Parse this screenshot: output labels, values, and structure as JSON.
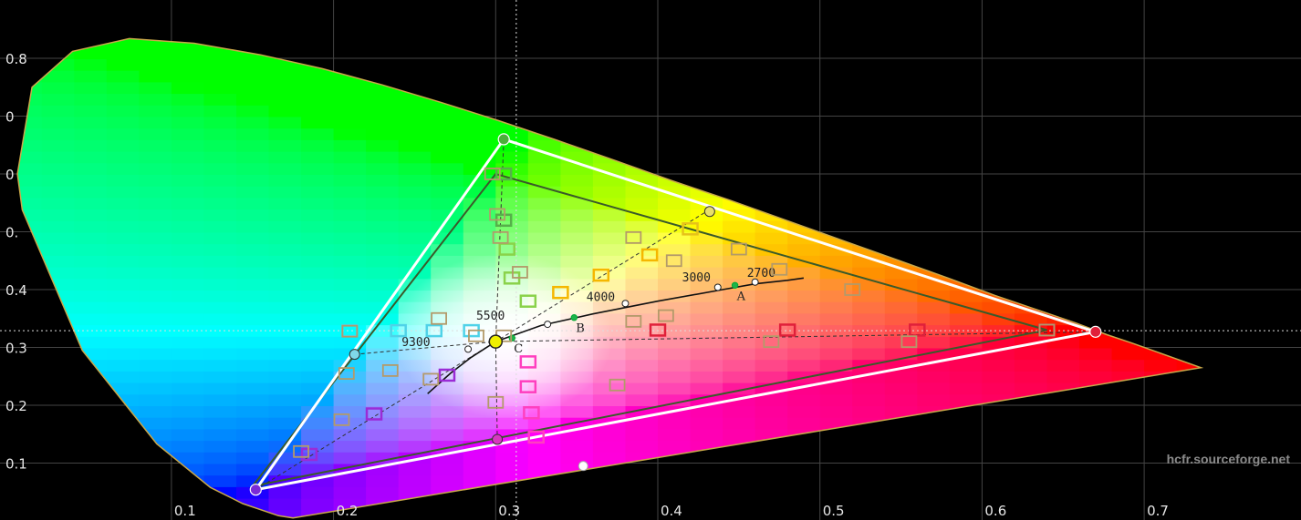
{
  "chart_data": {
    "type": "scatter",
    "title": "",
    "xlabel": "",
    "ylabel": "",
    "xlim": [
      0.0,
      0.8
    ],
    "ylim": [
      0.0,
      0.88
    ],
    "grid": true,
    "x_ticks": [
      "0.1",
      "0.2",
      "0.3",
      "0.4",
      "0.5",
      "0.6",
      "0.7"
    ],
    "y_ticks": [
      "0.1",
      "0.2",
      "0.3",
      "0.4",
      "0.5",
      "0.6",
      "0.7",
      "0.8"
    ],
    "y_ticks_visible": [
      "0.1",
      "0.2",
      "0.3",
      "0.4",
      "0.",
      "0",
      "0",
      "0.8"
    ],
    "spectral_locus": [
      [
        0.175,
        0.005
      ],
      [
        0.166,
        0.009
      ],
      [
        0.144,
        0.03
      ],
      [
        0.124,
        0.058
      ],
      [
        0.091,
        0.133
      ],
      [
        0.045,
        0.295
      ],
      [
        0.008,
        0.538
      ],
      [
        0.005,
        0.6
      ],
      [
        0.014,
        0.75
      ],
      [
        0.039,
        0.812
      ],
      [
        0.074,
        0.834
      ],
      [
        0.114,
        0.826
      ],
      [
        0.155,
        0.806
      ],
      [
        0.193,
        0.782
      ],
      [
        0.23,
        0.754
      ],
      [
        0.266,
        0.724
      ],
      [
        0.302,
        0.692
      ],
      [
        0.337,
        0.659
      ],
      [
        0.373,
        0.624
      ],
      [
        0.408,
        0.589
      ],
      [
        0.444,
        0.555
      ],
      [
        0.479,
        0.52
      ],
      [
        0.513,
        0.486
      ],
      [
        0.547,
        0.452
      ],
      [
        0.579,
        0.42
      ],
      [
        0.608,
        0.39
      ],
      [
        0.634,
        0.365
      ],
      [
        0.658,
        0.342
      ],
      [
        0.677,
        0.322
      ],
      [
        0.692,
        0.308
      ],
      [
        0.735,
        0.265
      ]
    ],
    "target_gamut": [
      [
        0.64,
        0.33
      ],
      [
        0.3,
        0.6
      ],
      [
        0.15,
        0.06
      ]
    ],
    "measured_gamut": [
      [
        0.67,
        0.327
      ],
      [
        0.305,
        0.66
      ],
      [
        0.152,
        0.054
      ]
    ],
    "target_secondaries": [
      [
        0.225,
        0.329
      ],
      [
        0.419,
        0.505
      ],
      [
        0.321,
        0.154
      ]
    ],
    "measured_secondaries": [
      [
        0.213,
        0.288
      ],
      [
        0.432,
        0.535
      ],
      [
        0.301,
        0.141
      ]
    ],
    "white_target": [
      0.3127,
      0.329
    ],
    "white_measured": [
      0.3,
      0.31
    ],
    "planckian_locus": [
      [
        0.258,
        0.22
      ],
      [
        0.272,
        0.255
      ],
      [
        0.285,
        0.283
      ],
      [
        0.3,
        0.31
      ],
      [
        0.328,
        0.338
      ],
      [
        0.36,
        0.358
      ],
      [
        0.4,
        0.38
      ],
      [
        0.44,
        0.4
      ],
      [
        0.46,
        0.41
      ],
      [
        0.48,
        0.416
      ],
      [
        0.49,
        0.42
      ]
    ],
    "cct_markers": [
      {
        "label": "9300",
        "x": 0.283,
        "y": 0.297
      },
      {
        "label": "5500",
        "x": 0.332,
        "y": 0.34
      },
      {
        "label": "4000",
        "x": 0.38,
        "y": 0.376
      },
      {
        "label": "3000",
        "x": 0.437,
        "y": 0.404
      },
      {
        "label": "2700",
        "x": 0.46,
        "y": 0.413
      }
    ],
    "cct_label_pos": [
      {
        "label": "9300",
        "x": 0.242,
        "y": 0.302
      },
      {
        "label": "5500",
        "x": 0.288,
        "y": 0.348
      },
      {
        "label": "4000",
        "x": 0.356,
        "y": 0.38
      },
      {
        "label": "3000",
        "x": 0.415,
        "y": 0.414
      },
      {
        "label": "2700",
        "x": 0.455,
        "y": 0.422
      }
    ],
    "illuminants": [
      {
        "label": "A",
        "x": 0.4476,
        "y": 0.4074
      },
      {
        "label": "B",
        "x": 0.3484,
        "y": 0.3516
      },
      {
        "label": "C",
        "x": 0.3101,
        "y": 0.3162
      }
    ],
    "saturation_targets": [
      {
        "x": 0.21,
        "y": 0.329,
        "c": "#4fd2e8"
      },
      {
        "x": 0.24,
        "y": 0.329,
        "c": "#4fd2e8"
      },
      {
        "x": 0.262,
        "y": 0.329,
        "c": "#4fd2e8"
      },
      {
        "x": 0.285,
        "y": 0.329,
        "c": "#4fd2e8"
      },
      {
        "x": 0.305,
        "y": 0.6,
        "c": "#56b04a"
      },
      {
        "x": 0.305,
        "y": 0.52,
        "c": "#56b04a"
      },
      {
        "x": 0.307,
        "y": 0.47,
        "c": "#8ad24a"
      },
      {
        "x": 0.31,
        "y": 0.42,
        "c": "#8ad24a"
      },
      {
        "x": 0.32,
        "y": 0.38,
        "c": "#8ad24a"
      },
      {
        "x": 0.42,
        "y": 0.505,
        "c": "#e6c21a"
      },
      {
        "x": 0.395,
        "y": 0.46,
        "c": "#f5b700"
      },
      {
        "x": 0.365,
        "y": 0.425,
        "c": "#f5b700"
      },
      {
        "x": 0.34,
        "y": 0.395,
        "c": "#f5b700"
      },
      {
        "x": 0.4,
        "y": 0.33,
        "c": "#e0203a"
      },
      {
        "x": 0.48,
        "y": 0.33,
        "c": "#e0203a"
      },
      {
        "x": 0.56,
        "y": 0.33,
        "c": "#e0203a"
      },
      {
        "x": 0.64,
        "y": 0.33,
        "c": "#e0203a"
      },
      {
        "x": 0.27,
        "y": 0.252,
        "c": "#9b2bd6"
      },
      {
        "x": 0.225,
        "y": 0.185,
        "c": "#9b2bd6"
      },
      {
        "x": 0.185,
        "y": 0.115,
        "c": "#9b2bd6"
      },
      {
        "x": 0.32,
        "y": 0.275,
        "c": "#ff3fbf"
      },
      {
        "x": 0.32,
        "y": 0.232,
        "c": "#ff3fbf"
      },
      {
        "x": 0.322,
        "y": 0.187,
        "c": "#ff3fbf"
      },
      {
        "x": 0.325,
        "y": 0.145,
        "c": "#ff3fbf"
      }
    ],
    "measured_points": [
      {
        "x": 0.21,
        "y": 0.328
      },
      {
        "x": 0.265,
        "y": 0.35
      },
      {
        "x": 0.288,
        "y": 0.32
      },
      {
        "x": 0.305,
        "y": 0.32
      },
      {
        "x": 0.298,
        "y": 0.6
      },
      {
        "x": 0.301,
        "y": 0.53
      },
      {
        "x": 0.303,
        "y": 0.49
      },
      {
        "x": 0.315,
        "y": 0.43
      },
      {
        "x": 0.385,
        "y": 0.49
      },
      {
        "x": 0.45,
        "y": 0.47
      },
      {
        "x": 0.41,
        "y": 0.45
      },
      {
        "x": 0.475,
        "y": 0.435
      },
      {
        "x": 0.52,
        "y": 0.4
      },
      {
        "x": 0.385,
        "y": 0.345
      },
      {
        "x": 0.405,
        "y": 0.355
      },
      {
        "x": 0.47,
        "y": 0.31
      },
      {
        "x": 0.555,
        "y": 0.31
      },
      {
        "x": 0.64,
        "y": 0.33
      },
      {
        "x": 0.26,
        "y": 0.245
      },
      {
        "x": 0.235,
        "y": 0.26
      },
      {
        "x": 0.208,
        "y": 0.255
      },
      {
        "x": 0.205,
        "y": 0.175
      },
      {
        "x": 0.18,
        "y": 0.12
      },
      {
        "x": 0.3,
        "y": 0.205
      },
      {
        "x": 0.375,
        "y": 0.235
      }
    ],
    "crosshair": {
      "x": 0.3127,
      "y": 0.329
    },
    "measured_lines": [
      [
        [
          0.152,
          0.054
        ],
        [
          0.3,
          0.31
        ],
        [
          0.43,
          0.535
        ]
      ],
      [
        [
          0.3,
          0.31
        ],
        [
          0.305,
          0.66
        ]
      ],
      [
        [
          0.213,
          0.288
        ],
        [
          0.3,
          0.31
        ],
        [
          0.67,
          0.327
        ]
      ],
      [
        [
          0.3,
          0.31
        ],
        [
          0.301,
          0.141
        ]
      ]
    ],
    "extra_dot": {
      "x": 0.354,
      "y": 0.095
    },
    "watermark": "hcfr.sourceforge.net",
    "colors": {
      "background": "#000000",
      "grid": "#444444",
      "target_gamut": "#ffffff",
      "measured_gamut": "#3a5a2a",
      "locus_stroke": "#c9a84a",
      "planckian": "#111111"
    }
  }
}
